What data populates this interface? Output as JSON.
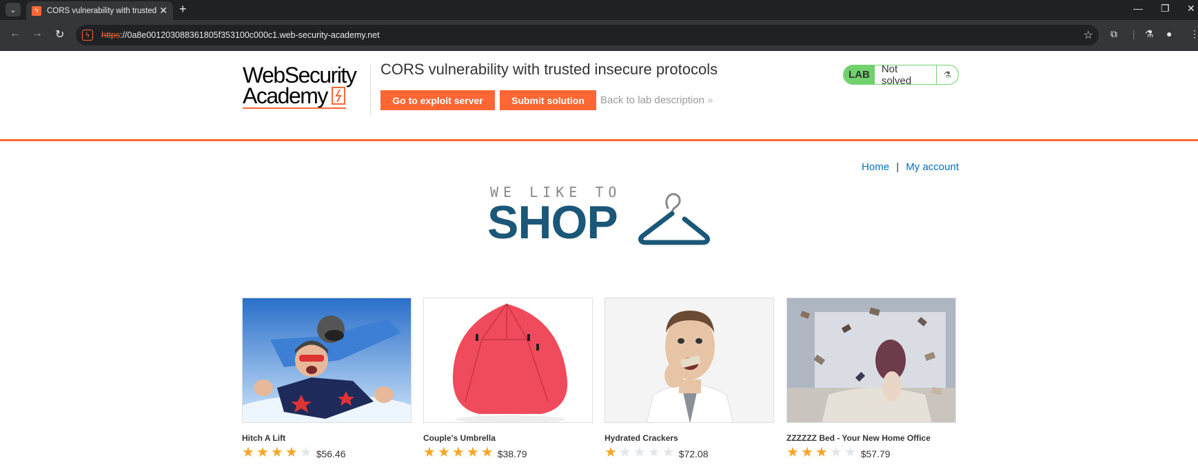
{
  "browser": {
    "tab_title": "CORS vulnerability with trusted",
    "url_scheme": "https",
    "url_rest": "://0a8e001203088361805f353100c000c1.web-security-academy.net"
  },
  "header": {
    "logo_line1": "WebSecurity",
    "logo_line2": "Academy",
    "lab_title": "CORS vulnerability with trusted insecure protocols",
    "exploit_button": "Go to exploit server",
    "submit_button": "Submit solution",
    "back_link": "Back to lab description",
    "back_chevron": "»",
    "lab_badge": "LAB",
    "lab_state": "Not solved"
  },
  "nav": {
    "home": "Home",
    "separator": "|",
    "my_account": "My account"
  },
  "banner": {
    "sub": "WE LIKE TO",
    "main": "SHOP"
  },
  "products": [
    {
      "name": "Hitch A Lift",
      "rating": 4,
      "price": "$56.46"
    },
    {
      "name": "Couple's Umbrella",
      "rating": 5,
      "price": "$38.79"
    },
    {
      "name": "Hydrated Crackers",
      "rating": 1,
      "price": "$72.08"
    },
    {
      "name": "ZZZZZZ Bed - Your New Home Office",
      "rating": 3,
      "price": "$57.79"
    }
  ],
  "colors": {
    "brand_orange": "#ff6633",
    "lab_green": "#70d16d",
    "link_blue": "#0071bc",
    "shop_blue": "#1b5778",
    "star_gold": "#f5a623"
  }
}
